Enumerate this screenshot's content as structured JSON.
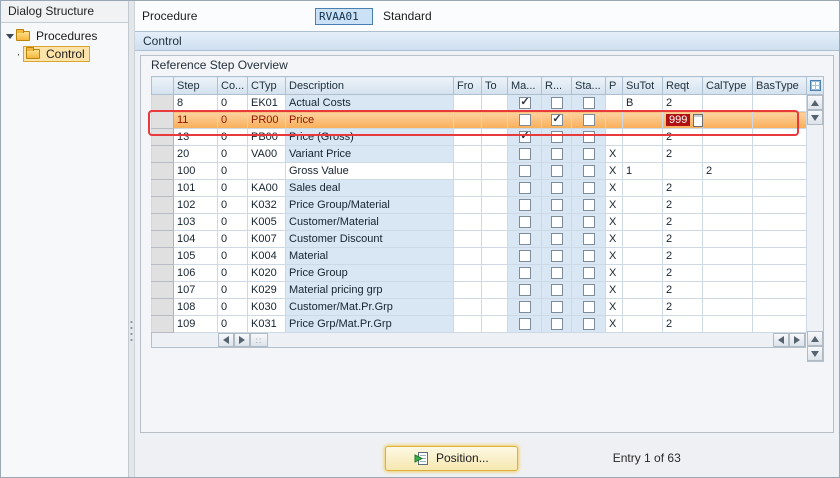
{
  "sidebar": {
    "title": "Dialog Structure",
    "items": [
      {
        "label": "Procedures",
        "level": 0,
        "expanded": true,
        "selected": false
      },
      {
        "label": "Control",
        "level": 1,
        "expanded": false,
        "selected": true
      }
    ]
  },
  "header": {
    "procedure_label": "Procedure",
    "procedure_value": "RVAA01",
    "procedure_text": "Standard"
  },
  "control_section": {
    "title": "Control",
    "overview_title": "Reference Step Overview"
  },
  "table": {
    "columns": [
      "Step",
      "Co...",
      "CTyp",
      "Description",
      "Fro",
      "To",
      "Ma...",
      "R...",
      "Sta...",
      "P",
      "SuTot",
      "Reqt",
      "CalType",
      "BasType"
    ],
    "rows": [
      {
        "step": "8",
        "co": "0",
        "ctyp": "EK01",
        "description": "Actual Costs",
        "fro": "",
        "to": "",
        "ma": true,
        "r": false,
        "sta": false,
        "p": "",
        "sutot": "B",
        "reqt": "2",
        "caltype": "",
        "bastype": "",
        "highlighted": false,
        "desc_white": false
      },
      {
        "step": "11",
        "co": "0",
        "ctyp": "PR00",
        "description": "Price",
        "fro": "",
        "to": "",
        "ma": false,
        "r": true,
        "sta": false,
        "p": "",
        "sutot": "",
        "reqt": "999",
        "caltype": "",
        "bastype": "",
        "highlighted": true,
        "desc_white": false
      },
      {
        "step": "13",
        "co": "0",
        "ctyp": "PB00",
        "description": "Price (Gross)",
        "fro": "",
        "to": "",
        "ma": true,
        "r": false,
        "sta": false,
        "p": "",
        "sutot": "",
        "reqt": "2",
        "caltype": "",
        "bastype": "",
        "highlighted": false,
        "desc_white": false
      },
      {
        "step": "20",
        "co": "0",
        "ctyp": "VA00",
        "description": "Variant Price",
        "fro": "",
        "to": "",
        "ma": false,
        "r": false,
        "sta": false,
        "p": "X",
        "sutot": "",
        "reqt": "2",
        "caltype": "",
        "bastype": "",
        "highlighted": false,
        "desc_white": false
      },
      {
        "step": "100",
        "co": "0",
        "ctyp": "",
        "description": "Gross Value",
        "fro": "",
        "to": "",
        "ma": false,
        "r": false,
        "sta": false,
        "p": "X",
        "sutot": "1",
        "reqt": "",
        "caltype": "2",
        "bastype": "",
        "highlighted": false,
        "desc_white": true
      },
      {
        "step": "101",
        "co": "0",
        "ctyp": "KA00",
        "description": "Sales deal",
        "fro": "",
        "to": "",
        "ma": false,
        "r": false,
        "sta": false,
        "p": "X",
        "sutot": "",
        "reqt": "2",
        "caltype": "",
        "bastype": "",
        "highlighted": false,
        "desc_white": false
      },
      {
        "step": "102",
        "co": "0",
        "ctyp": "K032",
        "description": "Price Group/Material",
        "fro": "",
        "to": "",
        "ma": false,
        "r": false,
        "sta": false,
        "p": "X",
        "sutot": "",
        "reqt": "2",
        "caltype": "",
        "bastype": "",
        "highlighted": false,
        "desc_white": false
      },
      {
        "step": "103",
        "co": "0",
        "ctyp": "K005",
        "description": "Customer/Material",
        "fro": "",
        "to": "",
        "ma": false,
        "r": false,
        "sta": false,
        "p": "X",
        "sutot": "",
        "reqt": "2",
        "caltype": "",
        "bastype": "",
        "highlighted": false,
        "desc_white": false
      },
      {
        "step": "104",
        "co": "0",
        "ctyp": "K007",
        "description": "Customer Discount",
        "fro": "",
        "to": "",
        "ma": false,
        "r": false,
        "sta": false,
        "p": "X",
        "sutot": "",
        "reqt": "2",
        "caltype": "",
        "bastype": "",
        "highlighted": false,
        "desc_white": false
      },
      {
        "step": "105",
        "co": "0",
        "ctyp": "K004",
        "description": "Material",
        "fro": "",
        "to": "",
        "ma": false,
        "r": false,
        "sta": false,
        "p": "X",
        "sutot": "",
        "reqt": "2",
        "caltype": "",
        "bastype": "",
        "highlighted": false,
        "desc_white": false
      },
      {
        "step": "106",
        "co": "0",
        "ctyp": "K020",
        "description": "Price Group",
        "fro": "",
        "to": "",
        "ma": false,
        "r": false,
        "sta": false,
        "p": "X",
        "sutot": "",
        "reqt": "2",
        "caltype": "",
        "bastype": "",
        "highlighted": false,
        "desc_white": false
      },
      {
        "step": "107",
        "co": "0",
        "ctyp": "K029",
        "description": "Material pricing grp",
        "fro": "",
        "to": "",
        "ma": false,
        "r": false,
        "sta": false,
        "p": "X",
        "sutot": "",
        "reqt": "2",
        "caltype": "",
        "bastype": "",
        "highlighted": false,
        "desc_white": false
      },
      {
        "step": "108",
        "co": "0",
        "ctyp": "K030",
        "description": "Customer/Mat.Pr.Grp",
        "fro": "",
        "to": "",
        "ma": false,
        "r": false,
        "sta": false,
        "p": "X",
        "sutot": "",
        "reqt": "2",
        "caltype": "",
        "bastype": "",
        "highlighted": false,
        "desc_white": false
      },
      {
        "step": "109",
        "co": "0",
        "ctyp": "K031",
        "description": "Price Grp/Mat.Pr.Grp",
        "fro": "",
        "to": "",
        "ma": false,
        "r": false,
        "sta": false,
        "p": "X",
        "sutot": "",
        "reqt": "2",
        "caltype": "",
        "bastype": "",
        "highlighted": false,
        "desc_white": false
      }
    ]
  },
  "footer": {
    "position_button": "Position...",
    "entry_text": "Entry 1 of 63"
  },
  "icons": {
    "tree_expander": "triangle-down",
    "folder": "folder-icon",
    "table_settings": "grid-icon",
    "paste": "paste-icon",
    "position": "position-icon"
  },
  "colors": {
    "annotation": "#e8393d",
    "highlight_row": "#f9ae58",
    "highlight_row_light": "#fdd3a0",
    "highlight_text": "#8f1500",
    "selected_cell_bg": "#b01010",
    "selected_cell_text": "#ffffff",
    "field_focus_bg": "#cbe1f5",
    "row_desc_bg": "#d9e7f5"
  }
}
